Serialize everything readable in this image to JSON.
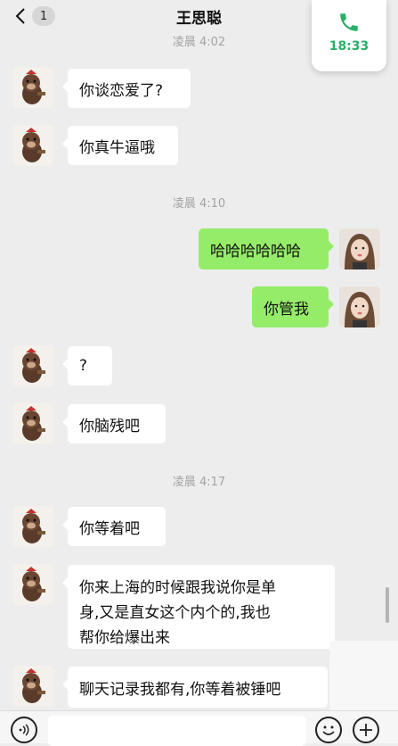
{
  "header": {
    "title": "王思聪",
    "unread_badge": "1"
  },
  "call_float": {
    "time": "18:33"
  },
  "messages": [
    {
      "kind": "time",
      "text": "凌晨 4:02"
    },
    {
      "kind": "msg",
      "side": "left",
      "text": "你谈恋爱了?"
    },
    {
      "kind": "msg",
      "side": "left",
      "text": "你真牛逼哦"
    },
    {
      "kind": "time",
      "text": "凌晨 4:10"
    },
    {
      "kind": "msg",
      "side": "right",
      "text": "哈哈哈哈哈哈"
    },
    {
      "kind": "msg",
      "side": "right",
      "text": "你管我"
    },
    {
      "kind": "msg",
      "side": "left",
      "text": "?"
    },
    {
      "kind": "msg",
      "side": "left",
      "text": "你脑残吧"
    },
    {
      "kind": "time",
      "text": "凌晨 4:17"
    },
    {
      "kind": "msg",
      "side": "left",
      "text": "你等着吧"
    },
    {
      "kind": "msg",
      "side": "left",
      "lines": [
        "你来上海的时候跟我说你是单",
        "身,又是直女这个内个的,我也",
        "帮你给爆出来"
      ]
    },
    {
      "kind": "msg",
      "side": "left",
      "text": "聊天记录我都有,你等着被锤吧"
    }
  ],
  "icons": {
    "back": "chevron-left-icon",
    "call": "phone-icon",
    "voice": "voice-icon",
    "emoji": "emoji-icon",
    "plus": "plus-icon"
  },
  "colors": {
    "outgoing_bubble": "#95ec69",
    "incoming_bubble": "#ffffff",
    "call_green": "#2aae67",
    "background": "#ededed"
  }
}
